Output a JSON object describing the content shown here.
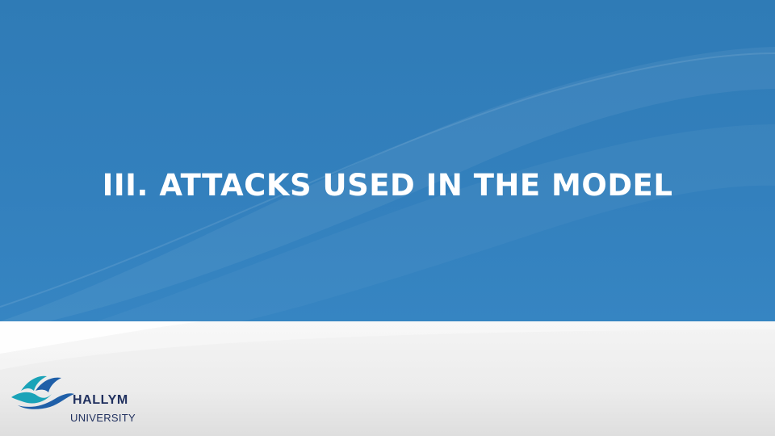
{
  "slide": {
    "title": "III. ATTACKS USED IN THE MODEL",
    "colors": {
      "primary_blue": "#3380bd",
      "footer_gray": "#ececec",
      "title_text": "#ffffff",
      "logo_text": "#1f2f5e",
      "logo_wave_teal": "#1aa3b8",
      "logo_wave_blue": "#1f5fa8"
    }
  },
  "logo": {
    "name": "HALLYM",
    "subtitle": "UNIVERSITY",
    "icon": "hallym-wave-logo-icon"
  }
}
